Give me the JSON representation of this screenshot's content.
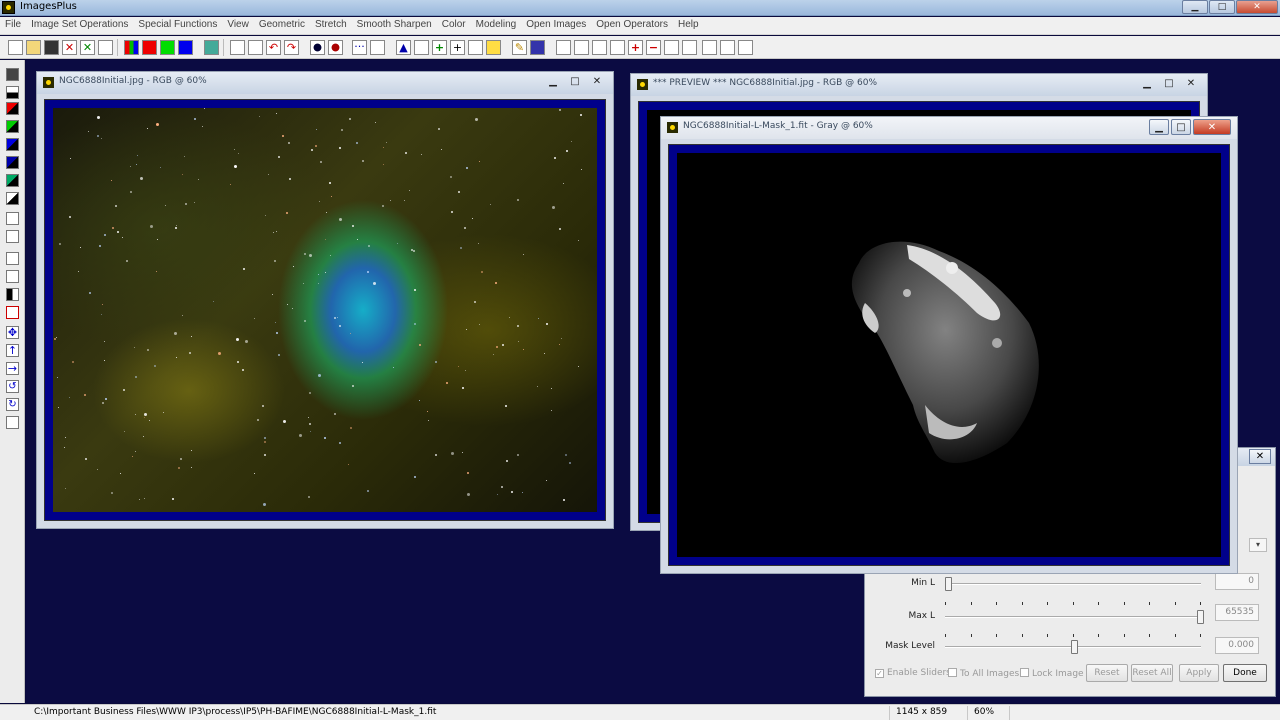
{
  "app": {
    "title": "ImagesPlus"
  },
  "menu": [
    "File",
    "Image Set Operations",
    "Special Functions",
    "View",
    "Geometric",
    "Stretch",
    "Smooth Sharpen",
    "Color",
    "Modeling",
    "Open Images",
    "Open Operators",
    "Help"
  ],
  "windows": {
    "rgb": {
      "title": "NGC6888Initial.jpg - RGB @ 60%"
    },
    "preview": {
      "title": "*** PREVIEW *** NGC6888Initial.jpg - RGB @ 60%"
    },
    "mask": {
      "title": "NGC6888Initial-L-Mask_1.fit - Gray @ 60%"
    }
  },
  "window_buttons": {
    "minimize": "▁",
    "maximize": "□",
    "close": "✕"
  },
  "dialog": {
    "close": "✕",
    "sliders": [
      {
        "label": "Min L",
        "value": "0",
        "level": 0.0
      },
      {
        "label": "Max L",
        "value": "65535",
        "level": 1.0
      },
      {
        "label": "Mask Level",
        "value": "0.000",
        "level": 0.5
      }
    ],
    "checks": [
      {
        "label": "Enable Sliders",
        "checked": true
      },
      {
        "label": "To All Images",
        "checked": false
      },
      {
        "label": "Lock Image",
        "checked": false
      }
    ],
    "buttons": {
      "reset": "Reset",
      "reset_all": "Reset All",
      "apply": "Apply",
      "done": "Done"
    }
  },
  "status": {
    "path": "C:\\Important Business Files\\WWW IP3\\process\\IP5\\PH-BAFIME\\NGC6888Initial-L-Mask_1.fit",
    "dims": "1145 x 859",
    "zoom": "60%"
  }
}
